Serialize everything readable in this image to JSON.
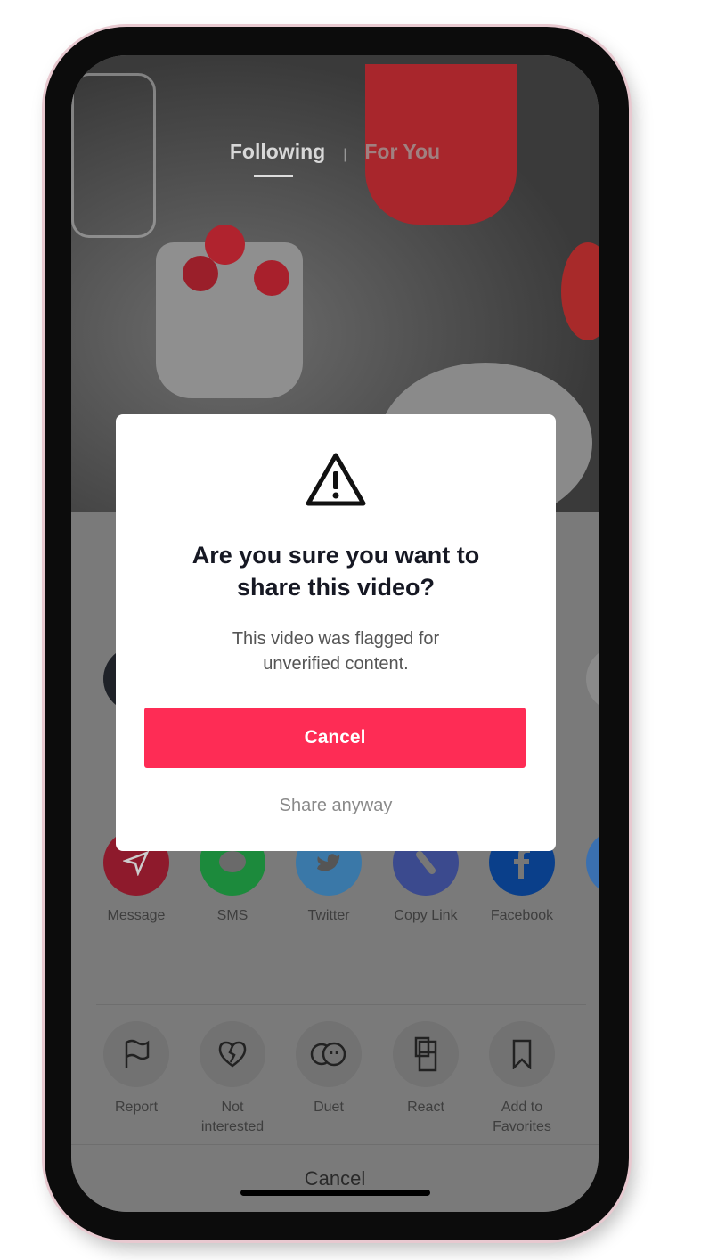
{
  "feed_tabs": [
    {
      "label": "Following",
      "active": true
    },
    {
      "label": "For You",
      "active": false
    }
  ],
  "tab_separator": "|",
  "dialog": {
    "icon": "warning-triangle-icon",
    "title_line1": "Are you sure you want to",
    "title_line2": "share this video?",
    "message_line1": "This video was flagged for",
    "message_line2": "unverified content.",
    "primary_label": "Cancel",
    "secondary_label": "Share anyway",
    "accent_color": "#fe2c55"
  },
  "share_targets": [
    {
      "label": "Message",
      "icon": "send-icon",
      "color": "#8e1a2c"
    },
    {
      "label": "SMS",
      "icon": "sms-bubble-icon",
      "color": "#1c8a3c"
    },
    {
      "label": "Twitter",
      "icon": "twitter-bird-icon",
      "color": "#3a78a8"
    },
    {
      "label": "Copy Link",
      "icon": "link-icon",
      "color": "#3b4a8e"
    },
    {
      "label": "Facebook",
      "icon": "facebook-icon",
      "color": "#0a3f8a"
    }
  ],
  "actions": [
    {
      "line1": "Report",
      "line2": "",
      "icon": "flag-icon"
    },
    {
      "line1": "Not",
      "line2": "interested",
      "icon": "broken-heart-icon"
    },
    {
      "line1": "Duet",
      "line2": "",
      "icon": "duet-icon"
    },
    {
      "line1": "React",
      "line2": "",
      "icon": "react-icon"
    },
    {
      "line1": "Add to",
      "line2": "Favorites",
      "icon": "bookmark-icon"
    }
  ],
  "sheet_cancel": "Cancel"
}
